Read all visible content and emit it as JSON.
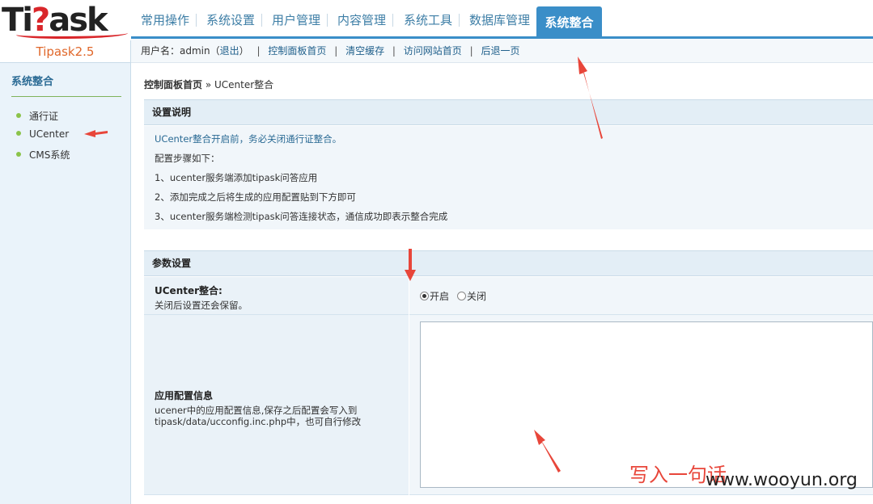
{
  "logo": {
    "text_before": "Ti",
    "text_q": "?",
    "text_after": "ask"
  },
  "version": "Tipask2.5",
  "topnav": {
    "items": [
      "常用操作",
      "系统设置",
      "用户管理",
      "内容管理",
      "系统工具",
      "数据库管理"
    ],
    "active": "系统整合"
  },
  "subbar": {
    "user_prefix": "用户名：admin（",
    "logout": "退出",
    "user_suffix": "）",
    "links": [
      "控制面板首页",
      "清空缓存",
      "访问网站首页",
      "后退一页"
    ]
  },
  "sidebar": {
    "title": "系统整合",
    "items": [
      "通行证",
      "UCenter",
      "CMS系统"
    ]
  },
  "breadcrumb": {
    "home": "控制面板首页",
    "sep": " » ",
    "current": "UCenter整合"
  },
  "desc": {
    "title": "设置说明",
    "lines": [
      "UCenter整合开启前，务必关闭通行证整合。",
      "配置步骤如下：",
      "1、ucenter服务端添加tipask问答应用",
      "2、添加完成之后将生成的应用配置贴到下方即可",
      "3、ucenter服务端检测tipask问答连接状态，通信成功即表示整合完成"
    ]
  },
  "params": {
    "title": "参数设置",
    "ucenter_label": "UCenter整合:",
    "ucenter_note": "关闭后设置还会保留。",
    "radio_on": "开启",
    "radio_off": "关闭",
    "radio_selected": "开启",
    "config_label": "应用配置信息",
    "config_note_1": "ucener中的应用配置信息,保存之后配置会写入到",
    "config_note_2": "tipask/data/ucconfig.inc.php中，也可自行修改",
    "config_value": ""
  },
  "annotation": "写入一句话",
  "watermark": "www.wooyun.org",
  "colors": {
    "accent": "#3a8ec8",
    "arrow": "#e8463a",
    "version": "#e0672a"
  }
}
